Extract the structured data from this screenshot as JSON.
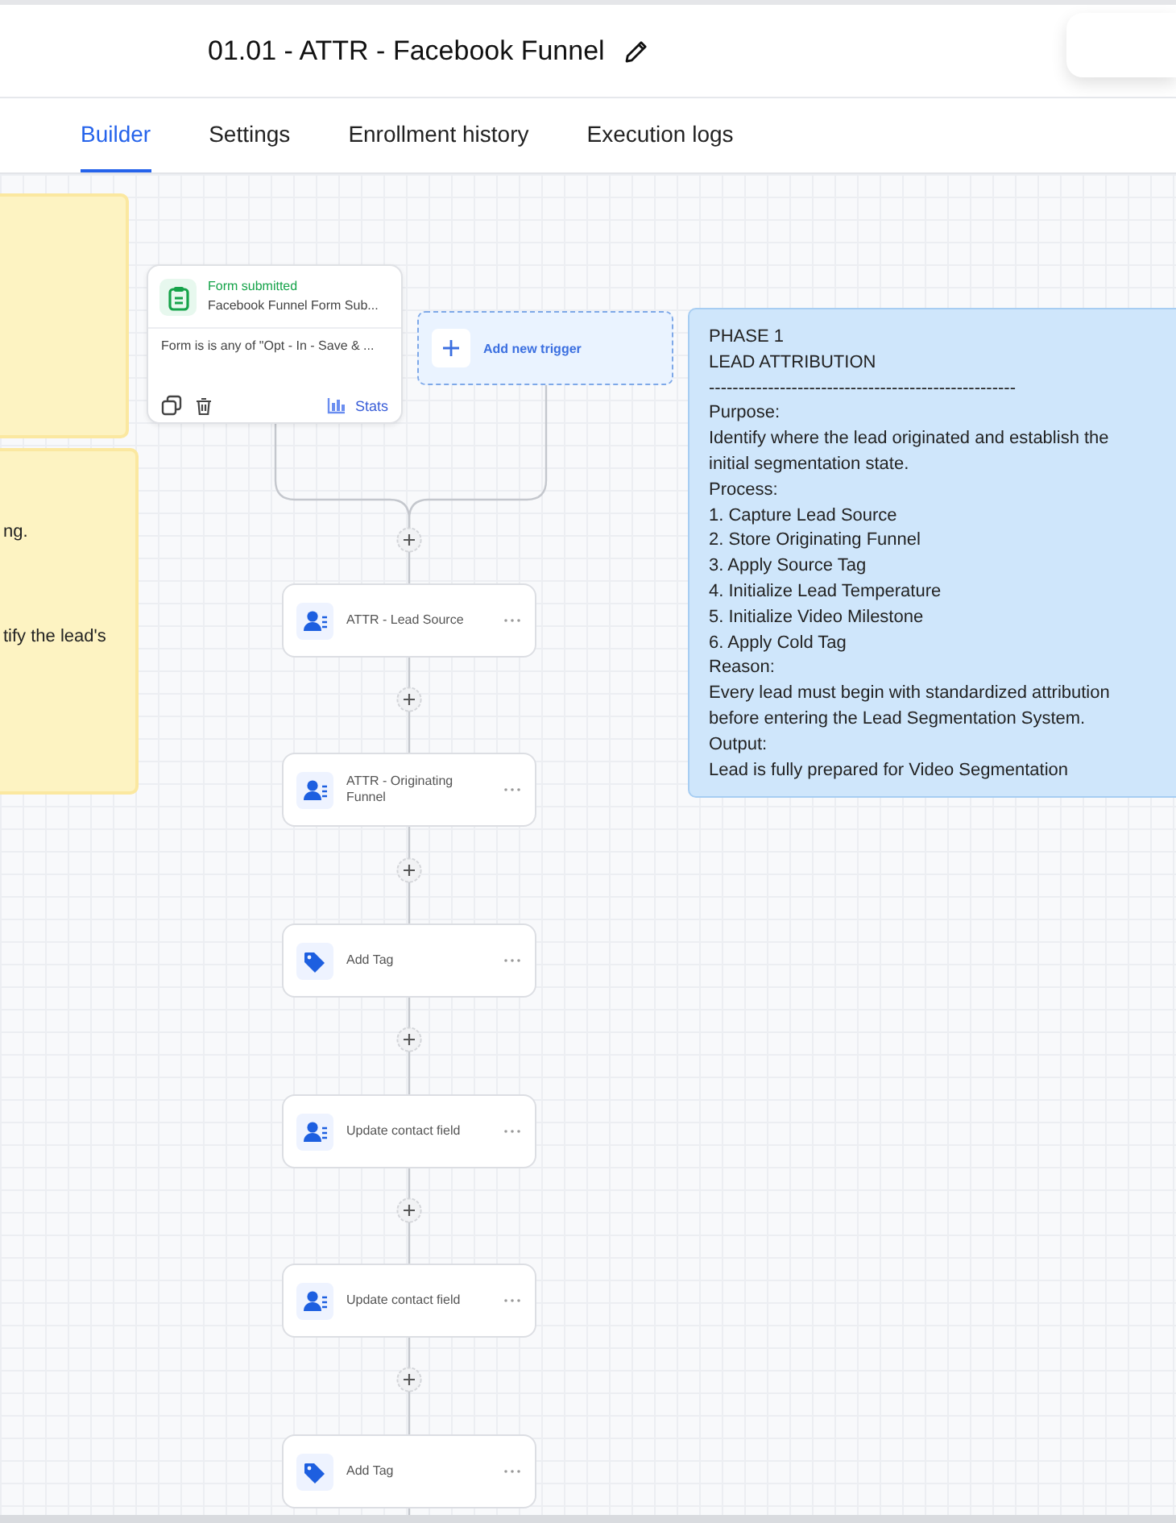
{
  "header": {
    "title": "01.01 - ATTR - Facebook Funnel"
  },
  "tabs": [
    {
      "label": "Builder",
      "selected": true
    },
    {
      "label": "Settings",
      "selected": false
    },
    {
      "label": "Enrollment history",
      "selected": false
    },
    {
      "label": "Execution logs",
      "selected": false
    }
  ],
  "notes": [
    {
      "kind": "sticky",
      "color": "#fdf3c2"
    },
    {
      "kind": "sticky",
      "color": "#fdf3c2",
      "lines": [
        "ng.",
        "tify the lead's"
      ]
    },
    {
      "kind": "sticky",
      "color": "#cfe6fb",
      "lines": [
        "PHASE 1",
        "LEAD ATTRIBUTION",
        "----------------------------------------------------",
        "Purpose:",
        "Identify where the lead originated and establish the",
        "initial segmentation state.",
        "Process:",
        "1. Capture Lead Source",
        "2. Store Originating Funnel",
        "3. Apply Source Tag",
        "4. Initialize Lead Temperature",
        "5. Initialize Video Milestone",
        "6. Apply Cold Tag",
        "Reason:",
        "Every lead must begin with standardized attribution",
        "before entering the Lead Segmentation System.",
        "Output:",
        "Lead is fully prepared for Video Segmentation"
      ]
    }
  ],
  "trigger": {
    "title": "Form submitted",
    "subtitle": "Facebook Funnel Form Sub...",
    "condition": "Form is is any of \"Opt - In - Save & ...",
    "stats": "Stats"
  },
  "add_trigger": {
    "label": "Add new trigger"
  },
  "actions": [
    {
      "kind": "contact",
      "label": "ATTR - Lead Source"
    },
    {
      "kind": "contact",
      "label": "ATTR - Originating Funnel"
    },
    {
      "kind": "tag",
      "label": "Add Tag"
    },
    {
      "kind": "contact",
      "label": "Update contact field"
    },
    {
      "kind": "contact",
      "label": "Update contact field"
    },
    {
      "kind": "tag",
      "label": "Add Tag"
    }
  ]
}
